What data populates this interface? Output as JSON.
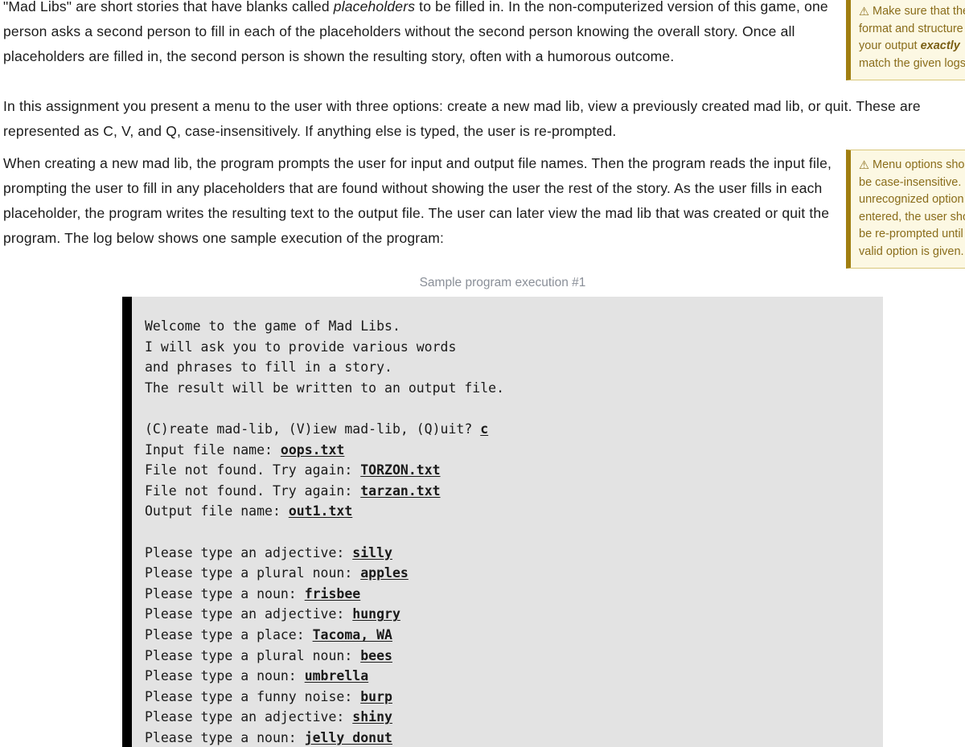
{
  "document": {
    "paragraphs": [
      {
        "id": "intro",
        "segments": [
          {
            "text": "\"Mad Libs\" are short stories that have blanks called ",
            "style": "normal"
          },
          {
            "text": "placeholders",
            "style": "italic"
          },
          {
            "text": " to be filled in. In the non-computerized version of this game, one person asks a second person to fill in each of the placeholders without the second person knowing the overall story. Once all placeholders are filled in, the second person is shown the resulting story, often with a humorous outcome.",
            "style": "normal"
          }
        ]
      },
      {
        "id": "menu-options",
        "segments": [
          {
            "text": "In this assignment you present a menu to the user with three options: create a new mad lib, view a previously created mad lib, or quit. These are represented as C, V, and Q, case-insensitively. If anything else is typed, the user is re-prompted.",
            "style": "normal"
          }
        ]
      },
      {
        "id": "creating",
        "segments": [
          {
            "text": "When creating a new mad lib, the program prompts the user for input and output file names. Then the program reads the input file, prompting the user to fill in any placeholders that are found without showing the user the rest of the story. As the user fills in each placeholder, the program writes the resulting text to the output file. The user can later view the mad lib that was created or quit the program. The log below shows one sample execution of the program:",
            "style": "normal"
          }
        ]
      }
    ]
  },
  "callouts": [
    {
      "id": "output-format",
      "icon": "warning-triangle-icon",
      "icon_glyph": "⚠",
      "segments": [
        {
          "text": "Make sure that the format and structure of your output ",
          "style": "normal"
        },
        {
          "text": "exactly",
          "style": "bold-italic"
        },
        {
          "text": " match the given logs.",
          "style": "normal"
        }
      ],
      "accent_color": "#a07e10",
      "background_color": "#fcf8e3",
      "text_color": "#8a6d1b"
    },
    {
      "id": "menu-case-insensitive",
      "icon": "warning-triangle-icon",
      "icon_glyph": "⚠",
      "segments": [
        {
          "text": "Menu options should be case-insensitive. If an unrecognized option is entered, the user should be re-prompted until a valid option is given.",
          "style": "normal"
        }
      ],
      "accent_color": "#a07e10",
      "background_color": "#fcf8e3",
      "text_color": "#8a6d1b"
    }
  ],
  "figure": {
    "caption": "Sample program execution #1",
    "caption_color": "#8a8f98",
    "terminal": {
      "background_color": "#e3e3e3",
      "gutter_color": "#000000",
      "text_color": "#1a1a1a",
      "lines": [
        [
          {
            "t": "Welcome to the game of Mad Libs.",
            "k": "out"
          }
        ],
        [
          {
            "t": "I will ask you to provide various words",
            "k": "out"
          }
        ],
        [
          {
            "t": "and phrases to fill in a story.",
            "k": "out"
          }
        ],
        [
          {
            "t": "The result will be written to an output file.",
            "k": "out"
          }
        ],
        [
          {
            "t": "",
            "k": "out"
          }
        ],
        [
          {
            "t": "(C)reate mad-lib, (V)iew mad-lib, (Q)uit? ",
            "k": "out"
          },
          {
            "t": "c",
            "k": "in"
          }
        ],
        [
          {
            "t": "Input file name: ",
            "k": "out"
          },
          {
            "t": "oops.txt",
            "k": "in"
          }
        ],
        [
          {
            "t": "File not found. Try again: ",
            "k": "out"
          },
          {
            "t": "TORZON.txt",
            "k": "in"
          }
        ],
        [
          {
            "t": "File not found. Try again: ",
            "k": "out"
          },
          {
            "t": "tarzan.txt",
            "k": "in"
          }
        ],
        [
          {
            "t": "Output file name: ",
            "k": "out"
          },
          {
            "t": "out1.txt",
            "k": "in"
          }
        ],
        [
          {
            "t": "",
            "k": "out"
          }
        ],
        [
          {
            "t": "Please type an adjective: ",
            "k": "out"
          },
          {
            "t": "silly",
            "k": "in"
          }
        ],
        [
          {
            "t": "Please type a plural noun: ",
            "k": "out"
          },
          {
            "t": "apples",
            "k": "in"
          }
        ],
        [
          {
            "t": "Please type a noun: ",
            "k": "out"
          },
          {
            "t": "frisbee",
            "k": "in"
          }
        ],
        [
          {
            "t": "Please type an adjective: ",
            "k": "out"
          },
          {
            "t": "hungry",
            "k": "in"
          }
        ],
        [
          {
            "t": "Please type a place: ",
            "k": "out"
          },
          {
            "t": "Tacoma, WA",
            "k": "in"
          }
        ],
        [
          {
            "t": "Please type a plural noun: ",
            "k": "out"
          },
          {
            "t": "bees",
            "k": "in"
          }
        ],
        [
          {
            "t": "Please type a noun: ",
            "k": "out"
          },
          {
            "t": "umbrella",
            "k": "in"
          }
        ],
        [
          {
            "t": "Please type a funny noise: ",
            "k": "out"
          },
          {
            "t": "burp",
            "k": "in"
          }
        ],
        [
          {
            "t": "Please type an adjective: ",
            "k": "out"
          },
          {
            "t": "shiny",
            "k": "in"
          }
        ],
        [
          {
            "t": "Please type a noun: ",
            "k": "out"
          },
          {
            "t": "jelly donut",
            "k": "in"
          }
        ]
      ]
    }
  }
}
